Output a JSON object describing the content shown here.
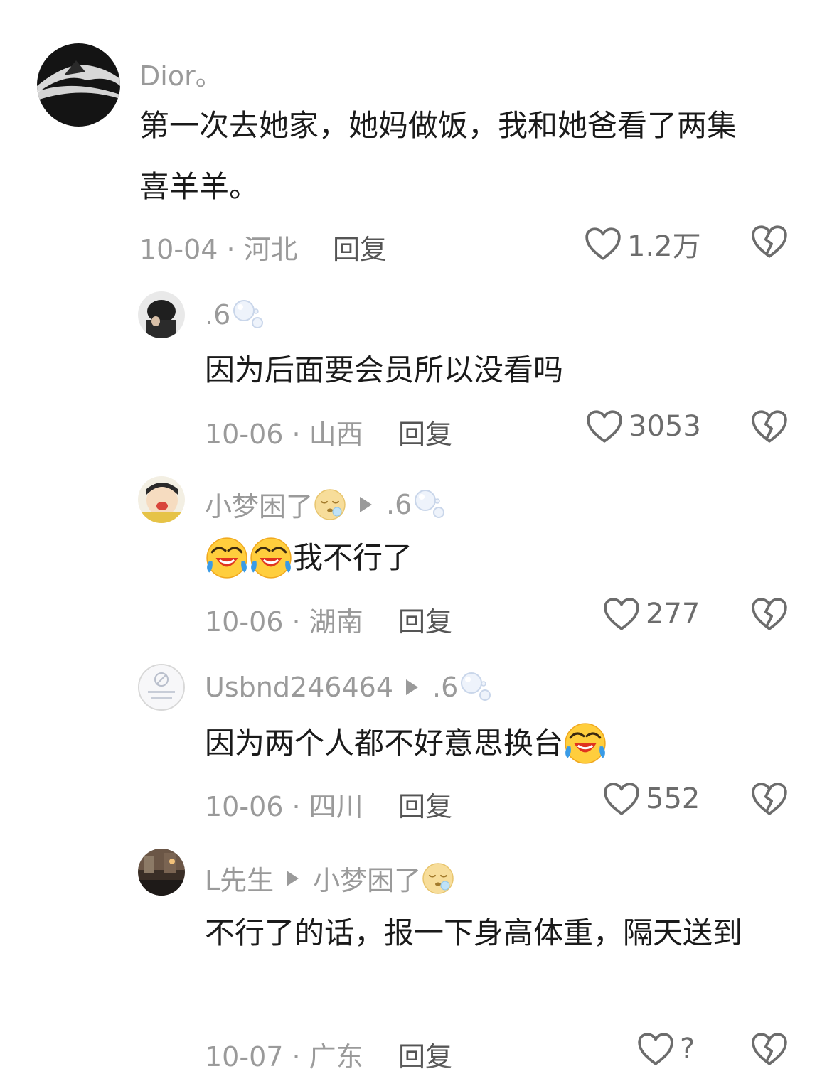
{
  "comments": [
    {
      "username": "Dior。",
      "text": "第一次去她家，她妈做饭，我和她爸看了两集喜羊羊。",
      "meta": "10-04 · 河北",
      "reply": "回复",
      "likes": "1.2万"
    },
    {
      "username": ".6",
      "text": "因为后面要会员所以没看吗",
      "meta": "10-06 · 山西",
      "reply": "回复",
      "likes": "3053"
    },
    {
      "username": "小梦困了",
      "reply_to": ".6",
      "text": "我不行了",
      "meta": "10-06 · 湖南",
      "reply": "回复",
      "likes": "277"
    },
    {
      "username": "Usbnd246464",
      "reply_to": ".6",
      "text": "因为两个人都不好意思换台",
      "meta": "10-06 · 四川",
      "reply": "回复",
      "likes": "552"
    },
    {
      "username": "L先生",
      "reply_to": "小梦困了",
      "text": "不行了的话，报一下身高体重，隔天送到",
      "meta": "10-07 · 广东",
      "reply": "回复",
      "likes": "?"
    }
  ],
  "icons": {
    "like": "heart-outline-icon",
    "dislike": "broken-heart-icon",
    "reply_arrow": "triangle-right-icon",
    "bubble": "bubble-decoration-icon",
    "sleepy": "sleepy-face-emoji",
    "laugh": "laugh-crying-emoji"
  },
  "colors": {
    "text": "#1a1a1a",
    "muted": "#9a9a9a",
    "icon": "#6c6c6c"
  }
}
